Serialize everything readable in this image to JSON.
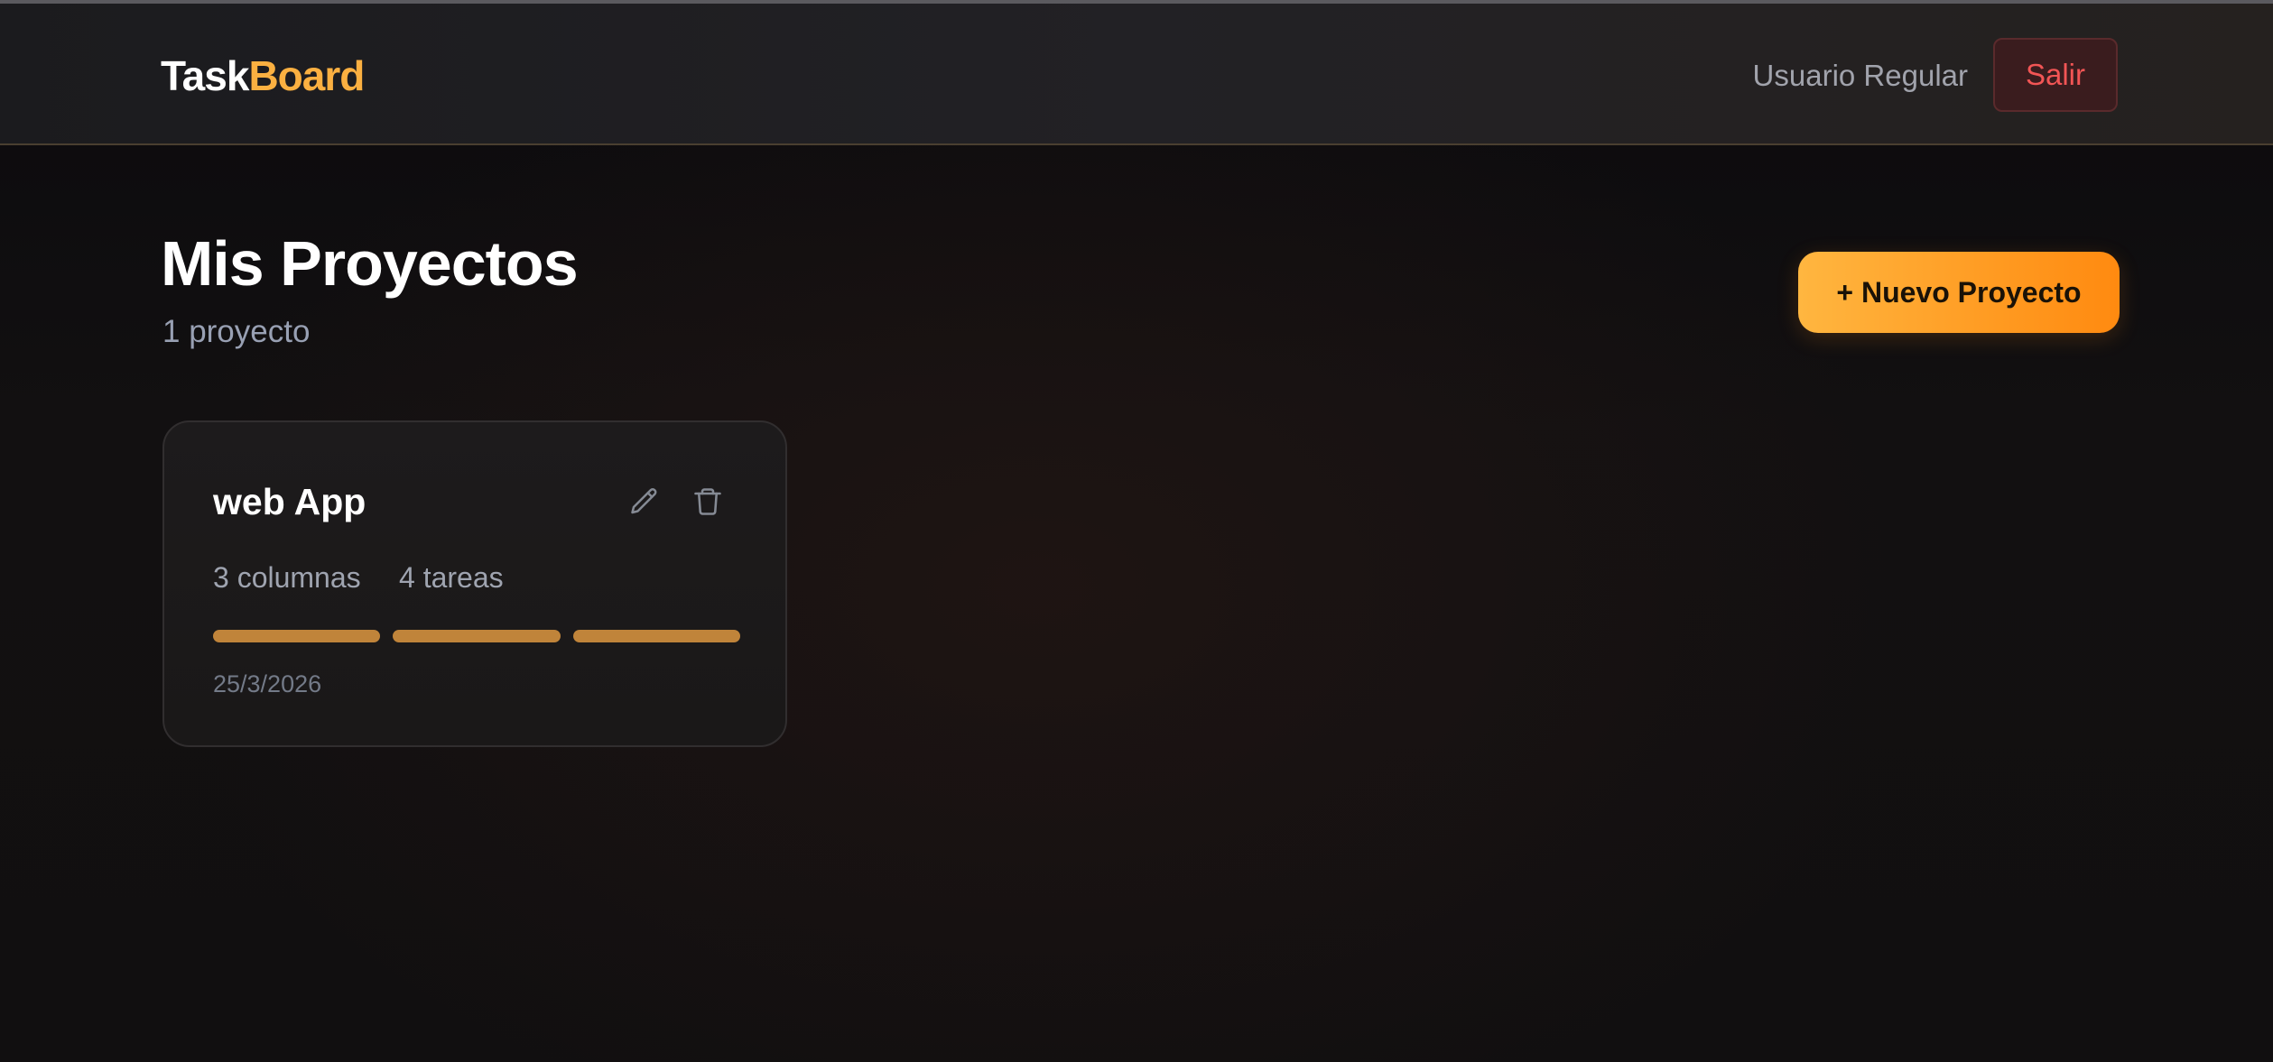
{
  "app": {
    "logo_part1": "Task",
    "logo_part2": "Board"
  },
  "header": {
    "user_name": "Usuario Regular",
    "logout_label": "Salir"
  },
  "main": {
    "title": "Mis Proyectos",
    "subtitle": "1 proyecto",
    "new_project_label": "+ Nuevo Proyecto"
  },
  "projects": [
    {
      "name": "web App",
      "columns_label": "3 columnas",
      "tasks_label": "4 tareas",
      "column_count": 3,
      "date": "25/3/2026"
    }
  ],
  "icons": {
    "edit": "pencil-icon",
    "delete": "trash-icon"
  },
  "colors": {
    "accent": "#fbb041",
    "accent_gradient_end": "#ff8a10",
    "danger": "#f25555",
    "column_bar": "#c0843a"
  }
}
